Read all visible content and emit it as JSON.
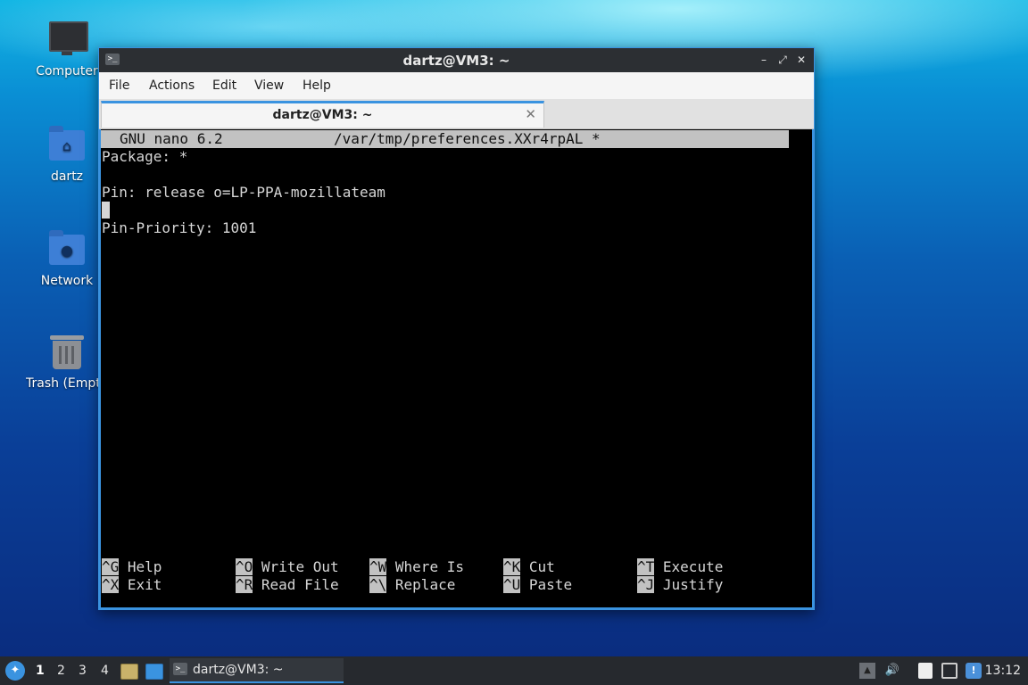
{
  "desktop": {
    "icons": [
      {
        "label": "Computer",
        "icon": "computer-icon"
      },
      {
        "label": "dartz",
        "icon": "home-folder-icon"
      },
      {
        "label": "Network",
        "icon": "network-folder-icon"
      },
      {
        "label": "Trash (Empt",
        "icon": "trash-icon"
      }
    ]
  },
  "window": {
    "title": "dartz@VM3: ~",
    "menu": [
      "File",
      "Actions",
      "Edit",
      "View",
      "Help"
    ],
    "tab_title": "dartz@VM3: ~",
    "controls": {
      "minimize": "–",
      "maximize": "⤢",
      "close": "✕"
    }
  },
  "nano": {
    "version": "GNU nano 6.2",
    "filename": "/var/tmp/preferences.XXr4rpAL *",
    "lines": [
      "Package: *",
      "",
      "Pin: release o=LP-PPA-mozillateam",
      "",
      "Pin-Priority: 1001"
    ],
    "shortcuts": [
      [
        {
          "key": "^G",
          "label": "Help"
        },
        {
          "key": "^O",
          "label": "Write Out"
        },
        {
          "key": "^W",
          "label": "Where Is"
        },
        {
          "key": "^K",
          "label": "Cut"
        },
        {
          "key": "^T",
          "label": "Execute"
        }
      ],
      [
        {
          "key": "^X",
          "label": "Exit"
        },
        {
          "key": "^R",
          "label": "Read File"
        },
        {
          "key": "^\\",
          "label": "Replace"
        },
        {
          "key": "^U",
          "label": "Paste"
        },
        {
          "key": "^J",
          "label": "Justify"
        }
      ]
    ]
  },
  "taskbar": {
    "workspaces": [
      "1",
      "2",
      "3",
      "4"
    ],
    "active_workspace": "1",
    "task_label": "dartz@VM3: ~",
    "clock": "13:12",
    "tray_icons": [
      "tray-up-icon",
      "volume-icon",
      "clipboard-icon",
      "network-icon",
      "update-notifier-icon"
    ]
  }
}
